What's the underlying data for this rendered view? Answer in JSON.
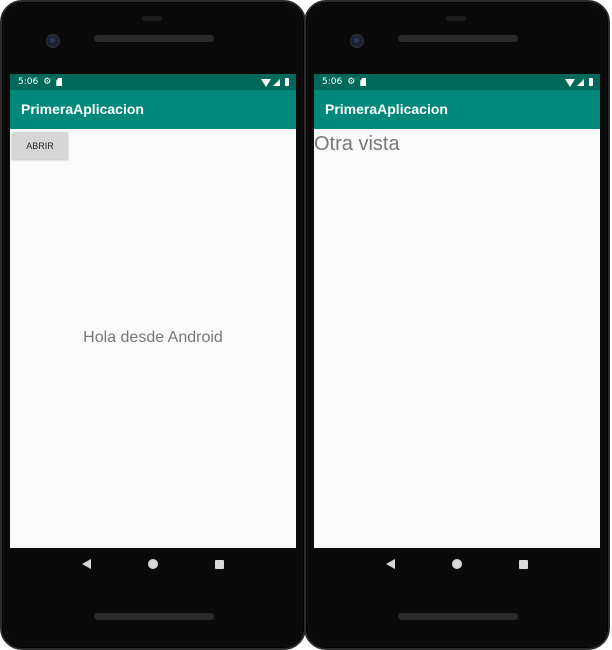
{
  "colors": {
    "status_bar": "#00695c",
    "app_bar": "#00897b",
    "screen_background": "#fafafa"
  },
  "left_screen": {
    "status": {
      "time": "5:06",
      "icons": [
        "gear-icon",
        "sd-card-icon",
        "wifi-icon",
        "signal-icon",
        "battery-icon"
      ]
    },
    "app_title": "PrimeraAplicacion",
    "button_label": "ABRIR",
    "center_text": "Hola desde Android"
  },
  "right_screen": {
    "status": {
      "time": "5:06",
      "icons": [
        "gear-icon",
        "sd-card-icon",
        "wifi-icon",
        "signal-icon",
        "battery-icon"
      ]
    },
    "app_title": "PrimeraAplicacion",
    "text": "Otra vista"
  },
  "nav_bar": {
    "icons": [
      "back-icon",
      "home-icon",
      "recents-icon"
    ]
  }
}
